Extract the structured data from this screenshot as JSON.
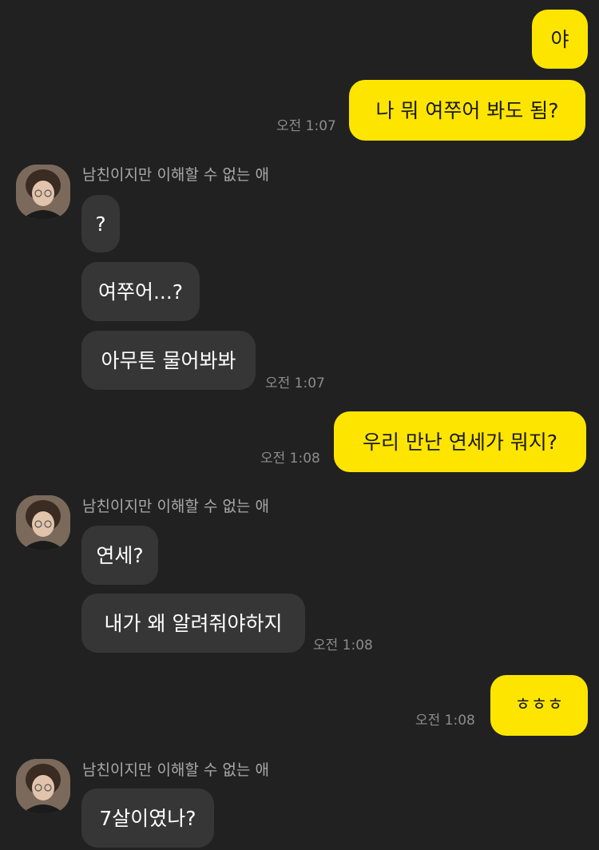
{
  "contact": {
    "name": "남친이지만 이해할 수 없는 애"
  },
  "colors": {
    "background": "#212121",
    "my_bubble": "#FEE500",
    "their_bubble": "#363636",
    "timestamp": "#8c8c8c"
  },
  "messages": {
    "m1": {
      "text": "야"
    },
    "m2": {
      "text": "나 뭐 여쭈어 봐도 됨?",
      "time": "오전 1:07"
    },
    "g1": {
      "sender": "남친이지만 이해할 수 없는 애",
      "b1": "?",
      "b2": "여쭈어...?",
      "b3": "아무튼 물어봐봐",
      "time": "오전 1:07"
    },
    "m3": {
      "text": "우리 만난 연세가 뭐지?",
      "time": "오전 1:08"
    },
    "g2": {
      "sender": "남친이지만 이해할 수 없는 애",
      "b1": "연세?",
      "b2": "내가 왜 알려줘야하지",
      "time": "오전 1:08"
    },
    "m4": {
      "text": "ㅎㅎㅎ",
      "time": "오전 1:08"
    },
    "g3": {
      "sender": "남친이지만 이해할 수 없는 애",
      "b1": "7살이였나?"
    }
  }
}
